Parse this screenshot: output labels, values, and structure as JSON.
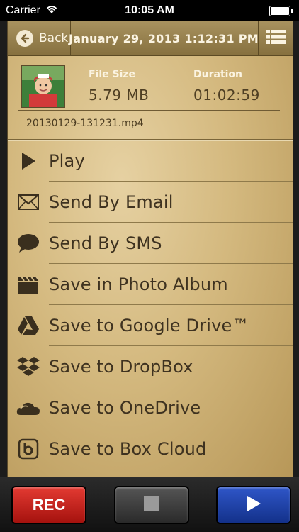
{
  "status_bar": {
    "carrier": "Carrier",
    "time": "10:05 AM"
  },
  "navbar": {
    "back_label": "Back",
    "title": "January 29, 2013 1:12:31 PM"
  },
  "file_info": {
    "file_size_label": "File Size",
    "file_size_value": "5.79 MB",
    "duration_label": "Duration",
    "duration_value": "01:02:59",
    "filename": "20130129-131231.mp4"
  },
  "menu": {
    "items": [
      {
        "label": "Play",
        "icon": "play-icon"
      },
      {
        "label": "Send By Email",
        "icon": "envelope-icon"
      },
      {
        "label": "Send By SMS",
        "icon": "speech-bubble-icon"
      },
      {
        "label": "Save in Photo Album",
        "icon": "clapperboard-icon"
      },
      {
        "label": "Save to Google Drive™",
        "icon": "google-drive-icon"
      },
      {
        "label": "Save to DropBox",
        "icon": "dropbox-icon"
      },
      {
        "label": "Save to OneDrive",
        "icon": "onedrive-cloud-icon"
      },
      {
        "label": "Save to Box Cloud",
        "icon": "box-icon"
      }
    ]
  },
  "toolbar": {
    "rec_label": "REC"
  },
  "colors": {
    "rec": "#d0231c",
    "play": "#1f44b0",
    "panel": "#d4b97f"
  }
}
